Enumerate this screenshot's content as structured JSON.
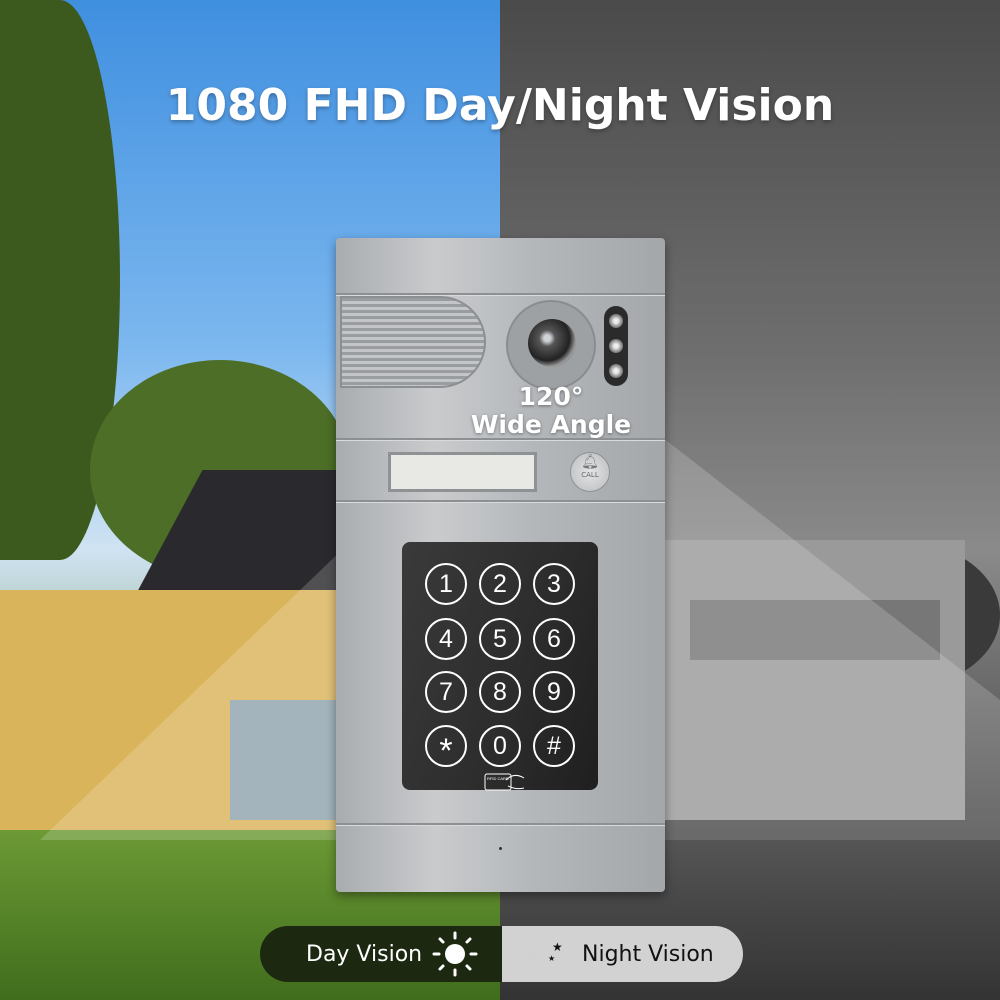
{
  "title": "1080 FHD Day/Night Vision",
  "camera": {
    "angle_value": "120°",
    "angle_label": "Wide Angle"
  },
  "call_button": {
    "label": "CALL",
    "icon": "bell-icon"
  },
  "keypad": {
    "keys": [
      "1",
      "2",
      "3",
      "4",
      "5",
      "6",
      "7",
      "8",
      "9",
      "*",
      "0",
      "#"
    ],
    "card_label": "RFID CARD",
    "card_icon": "rfid-card-icon"
  },
  "modes": {
    "day": {
      "label": "Day Vision",
      "icon": "sun-icon"
    },
    "night": {
      "label": "Night Vision",
      "icon": "moon-stars-icon"
    }
  },
  "colors": {
    "day_pill": "#1d2810",
    "night_pill": "#d2d2d2",
    "panel": "#b8babd"
  }
}
